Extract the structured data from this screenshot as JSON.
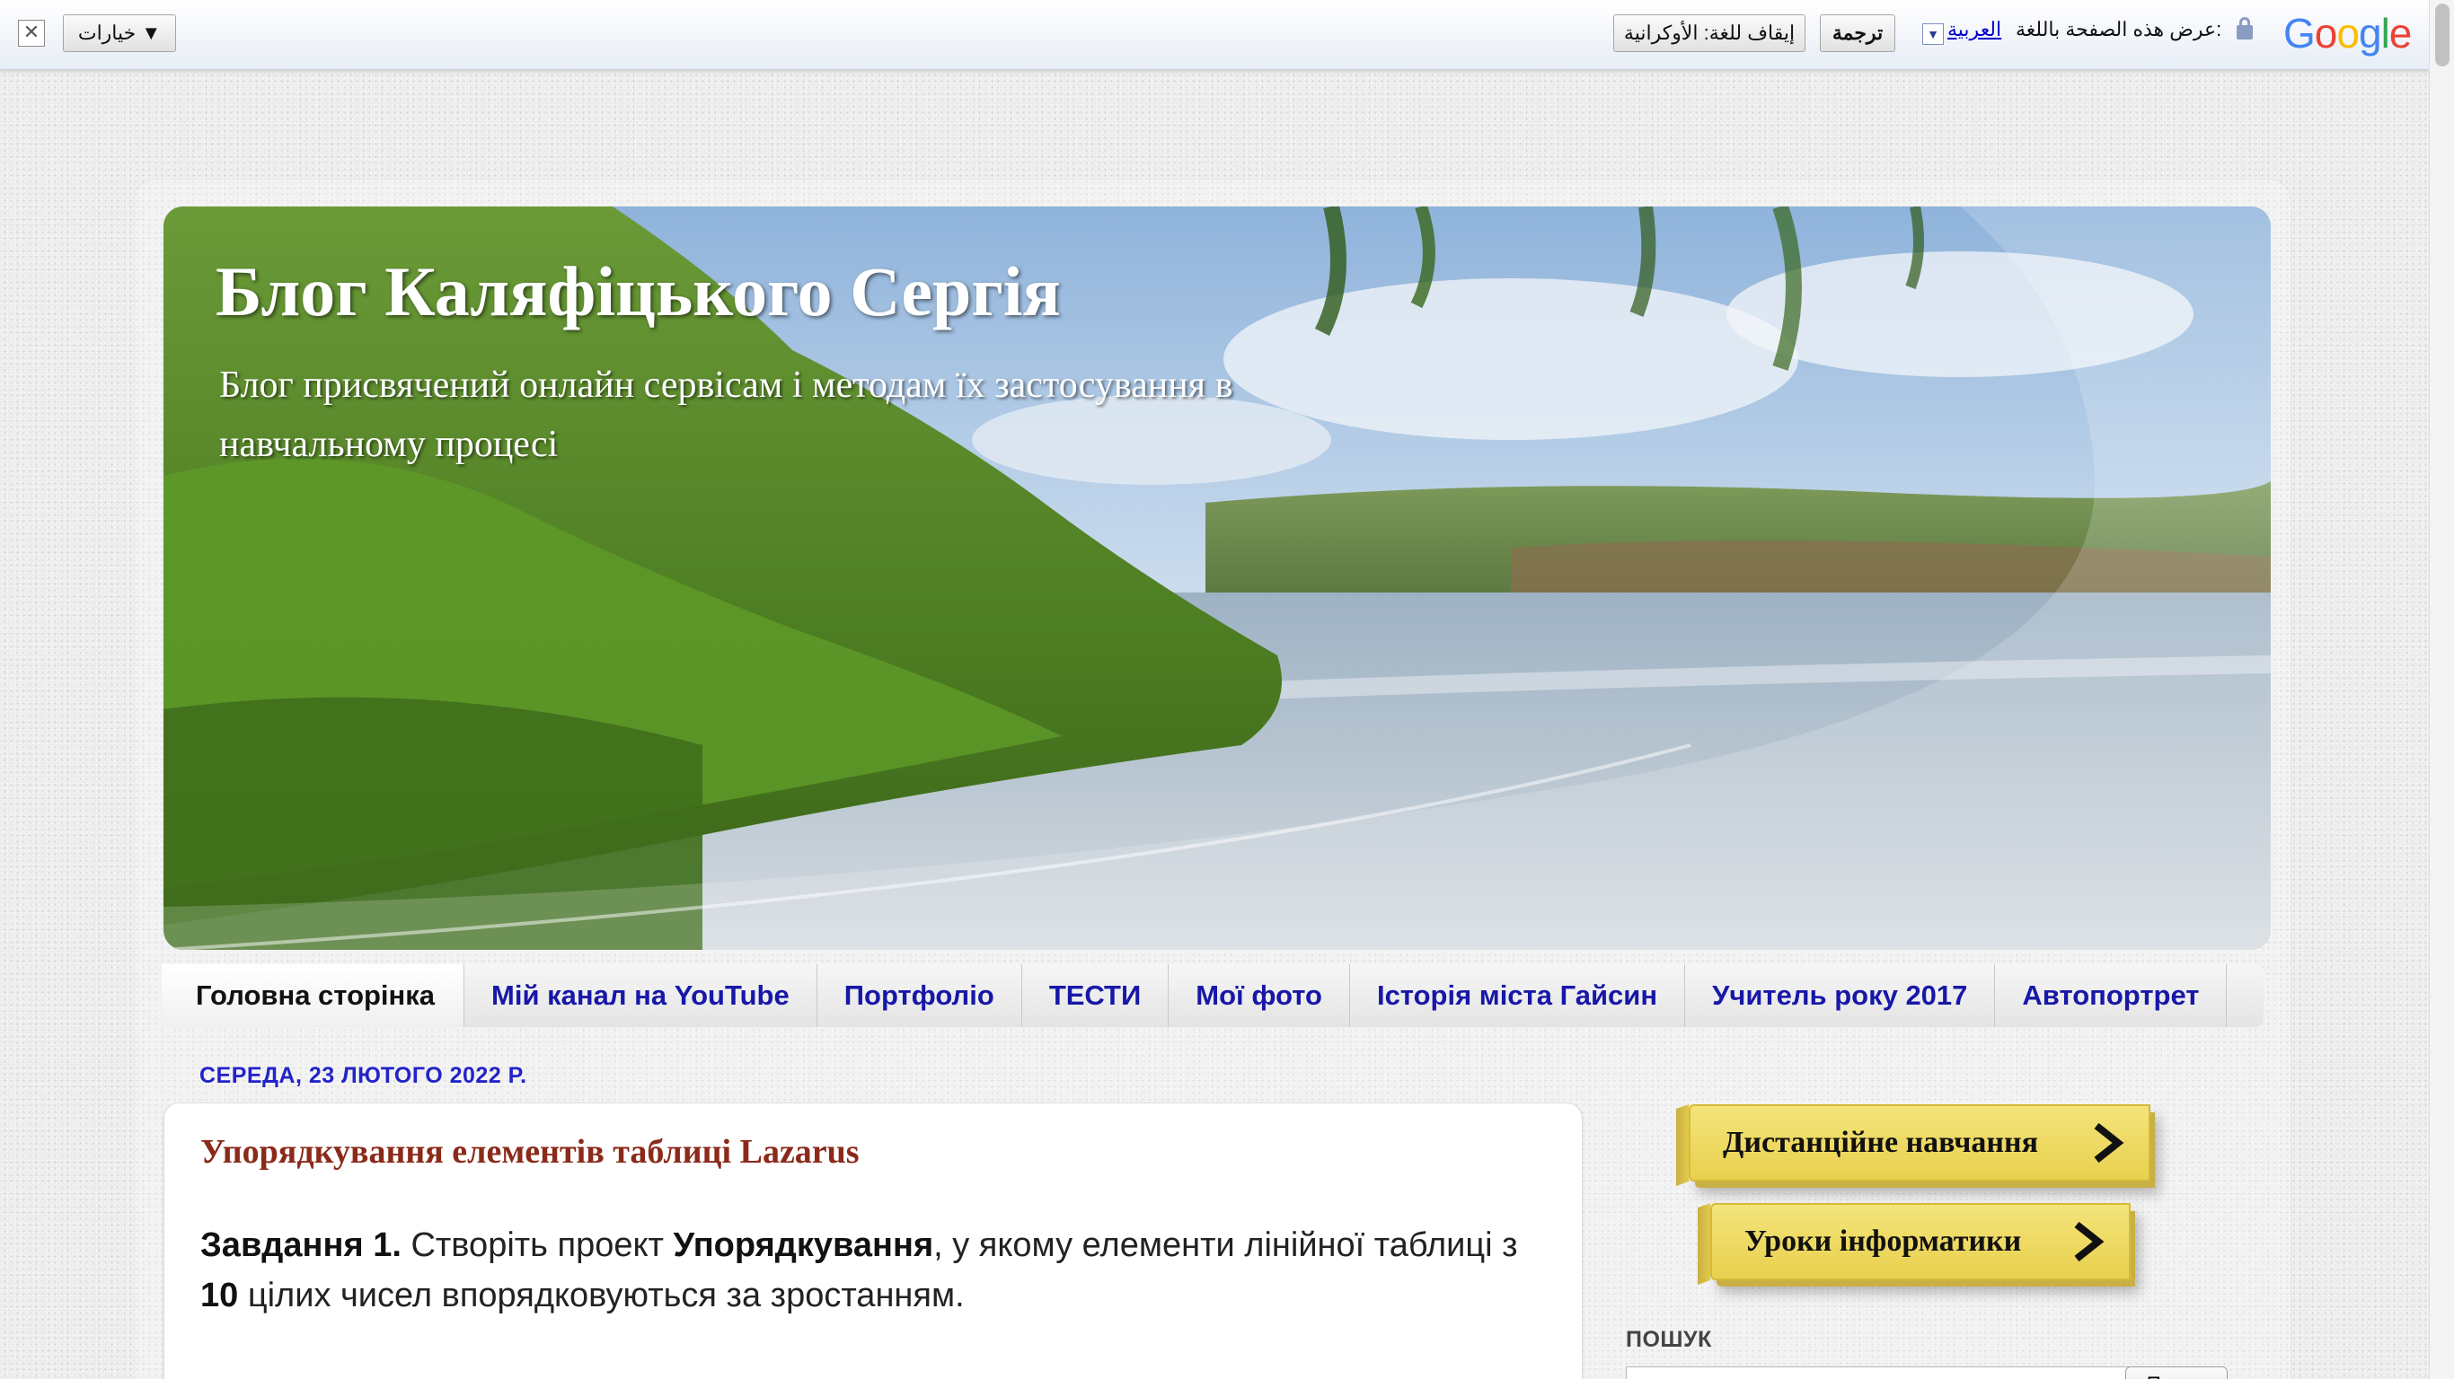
{
  "translate_bar": {
    "options_label": "خيارات ▼",
    "stop_label": "إيقاف للغة: الأوكرانية",
    "translate_label": "ترجمة",
    "language": "العربية",
    "view_text": "عرض هذه الصفحة باللغة:",
    "logo": [
      "G",
      "o",
      "o",
      "g",
      "l",
      "e"
    ]
  },
  "header": {
    "title": "Блог Каляфіцького Сергія",
    "description": "Блог присвячений онлайн сервісам і методам їх застосування в навчальному процесі"
  },
  "tabs": [
    {
      "label": "Головна сторінка",
      "active": true
    },
    {
      "label": "Мій канал на YouTube",
      "active": false
    },
    {
      "label": "Портфоліо",
      "active": false
    },
    {
      "label": "ТЕСТИ",
      "active": false
    },
    {
      "label": "Мої фото",
      "active": false
    },
    {
      "label": "Історія міста Гайсин",
      "active": false
    },
    {
      "label": "Учитель року 2017",
      "active": false
    },
    {
      "label": "Автопортрет",
      "active": false
    }
  ],
  "date_header": "СЕРЕДА, 23 ЛЮТОГО 2022 Р.",
  "post": {
    "title": "Упорядкування елементів таблиці Lazarus",
    "body_task_label": "Завдання 1.",
    "body_part1": " Створіть проект ",
    "body_project": "Упорядкування",
    "body_part2": ", у якому елементи лінійної таблиці з ",
    "body_count": "10",
    "body_part3": " цілих чисел впорядковуються за зростанням."
  },
  "sidebar": {
    "button1": "Дистанційне навчання",
    "button2": "Уроки інформатики",
    "search_label": "ПОШУК",
    "search_button": "Пошук"
  },
  "colors": {
    "link": "#1717a8",
    "post_title": "#8b2a1a",
    "date": "#2323c9",
    "button_yellow": "#f0dd6c"
  }
}
